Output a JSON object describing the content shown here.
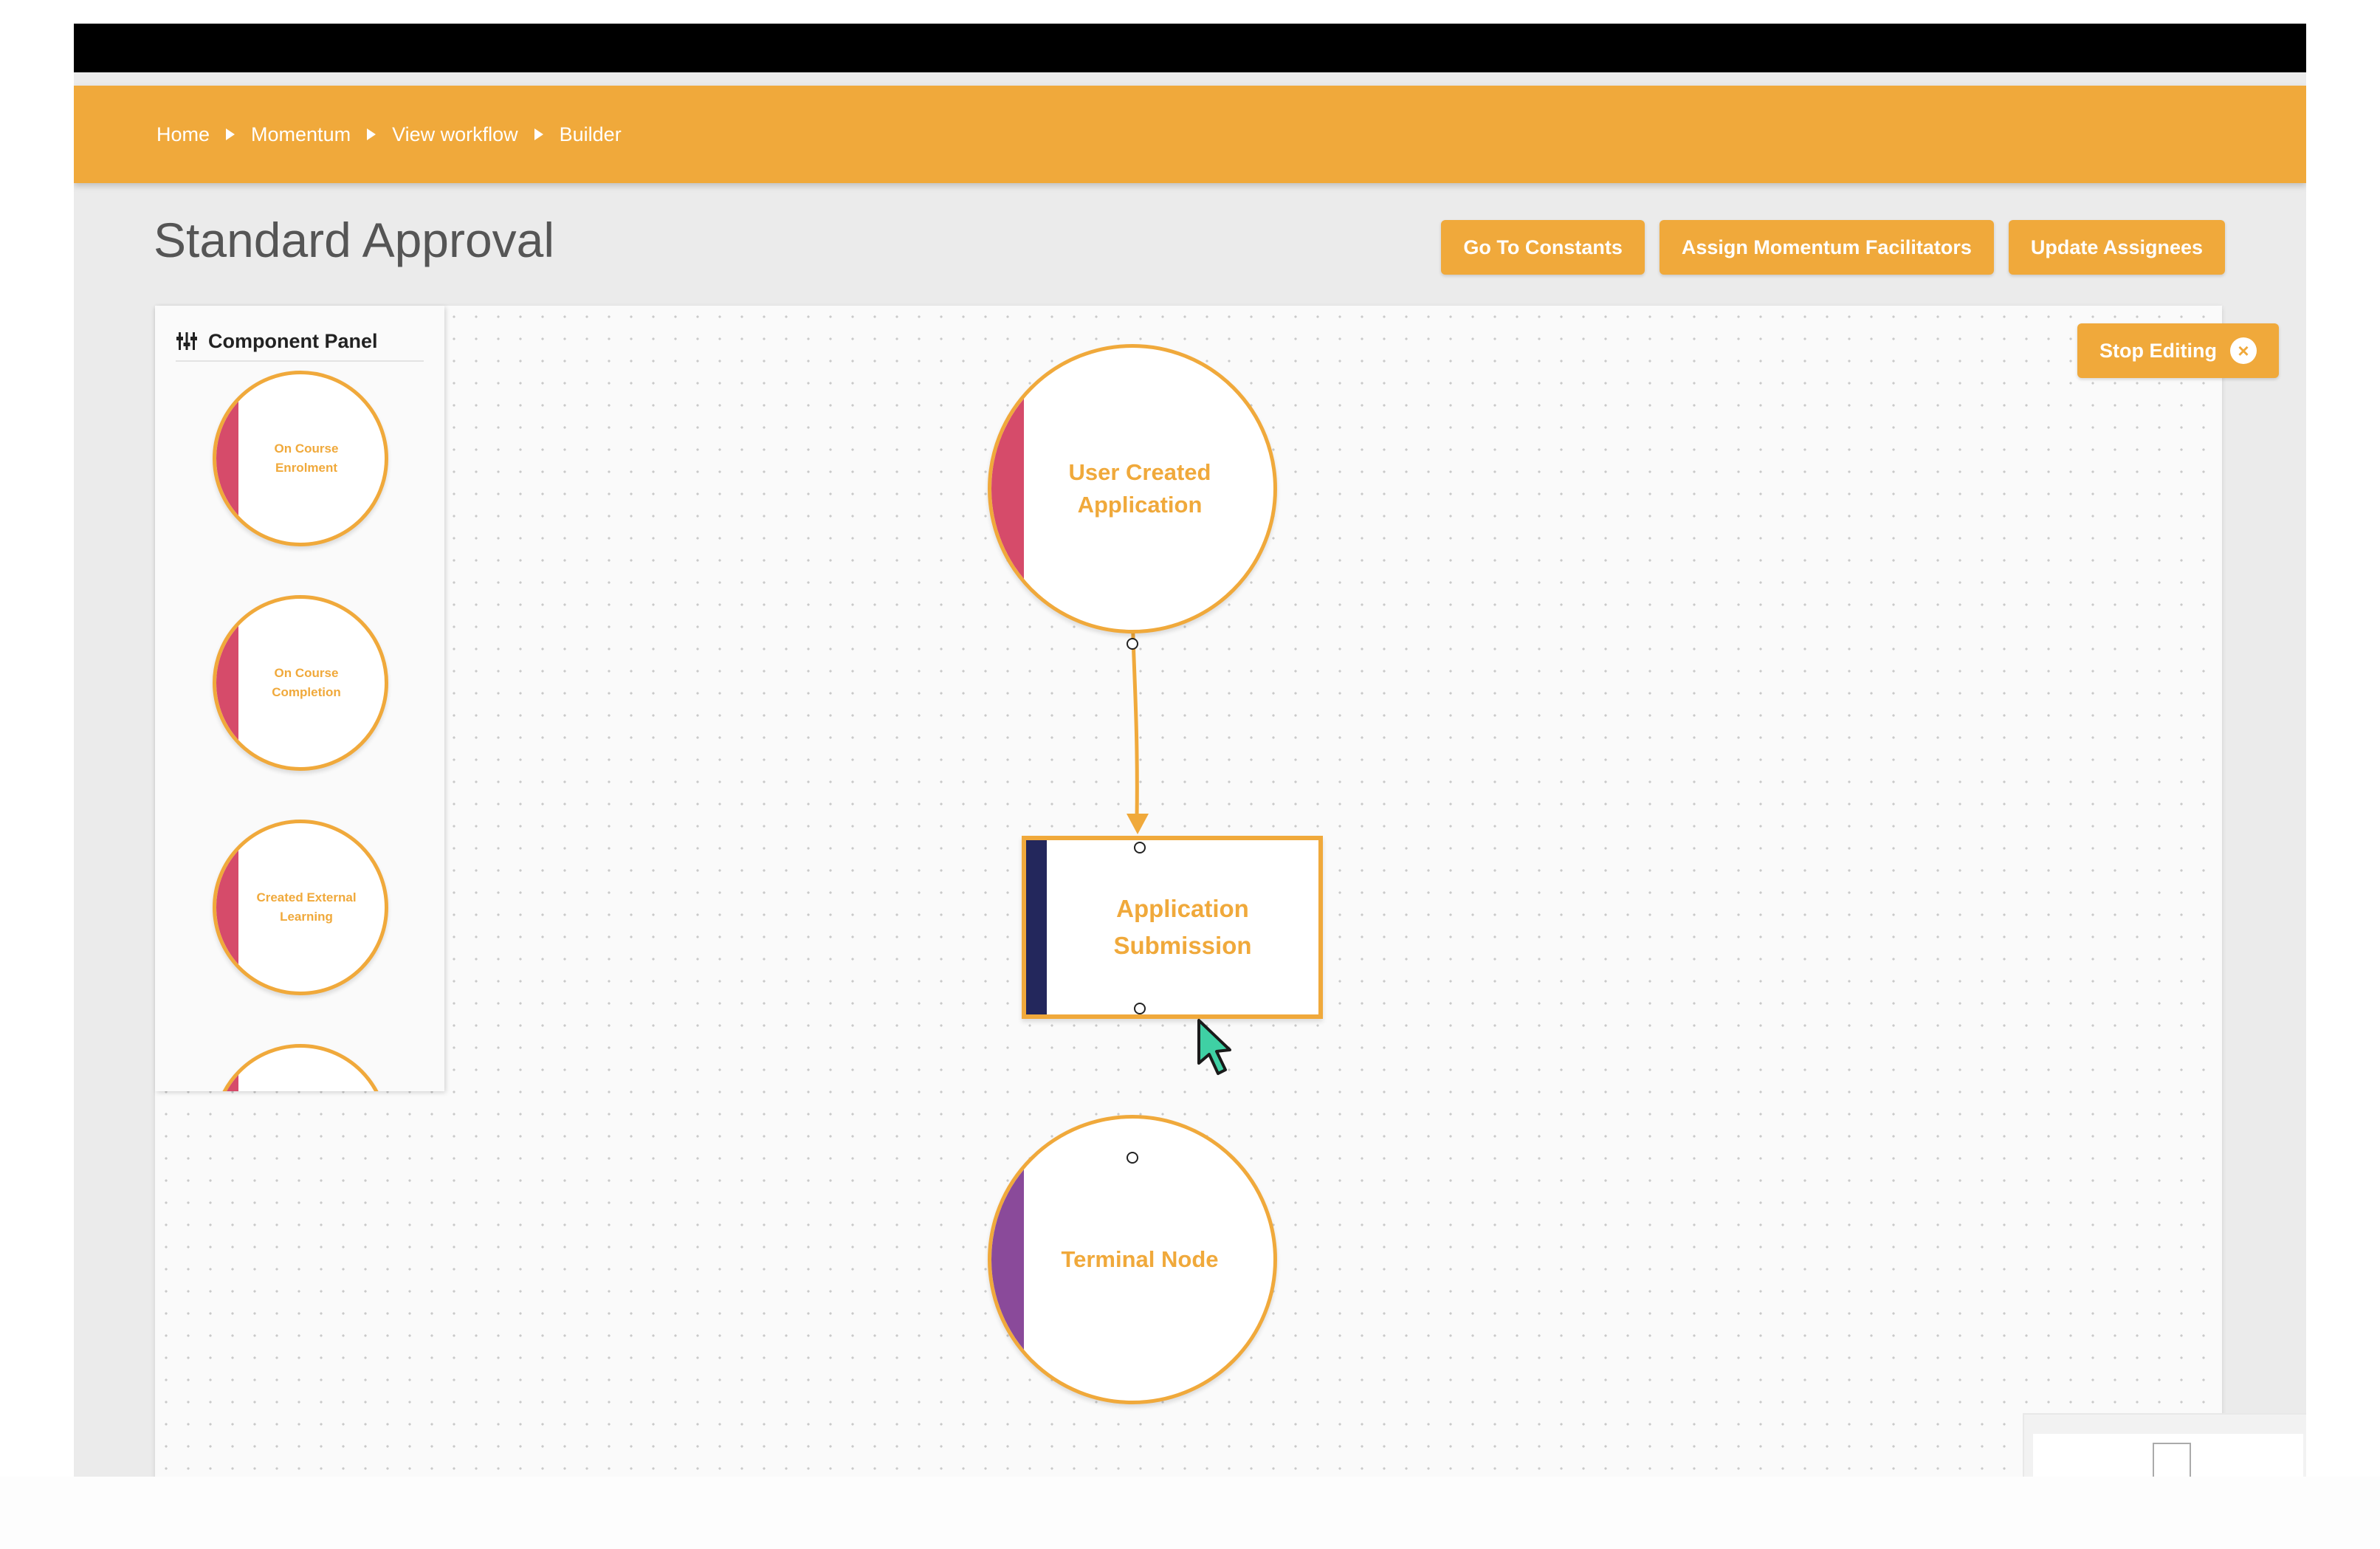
{
  "breadcrumb": {
    "items": [
      "Home",
      "Momentum",
      "View workflow",
      "Builder"
    ]
  },
  "page": {
    "title": "Standard Approval"
  },
  "actions": {
    "constants": "Go To Constants",
    "facilitators": "Assign Momentum Facilitators",
    "assignees": "Update Assignees"
  },
  "component_panel": {
    "title": "Component Panel",
    "title_icon": "sliders-icon",
    "items": [
      "On Course Enrolment",
      "On Course Completion",
      "Created External Learning",
      ""
    ]
  },
  "canvas": {
    "stop_editing": "Stop Editing",
    "stop_editing_icon": "close-circle-icon",
    "zoom_in": "+"
  },
  "workflow": {
    "nodes": [
      {
        "label": "User Created Application",
        "shape": "circle",
        "accent": "#d64b6a"
      },
      {
        "label": "Application Submission",
        "shape": "rectangle",
        "accent": "#23275c"
      },
      {
        "label": "Terminal Node",
        "shape": "circle",
        "accent": "#8a4a9a"
      }
    ],
    "edges": [
      {
        "from": "User Created Application",
        "to": "Application Submission"
      }
    ]
  },
  "colors": {
    "brand": "#f0a93b",
    "background": "#ebebeb",
    "cursor": "#3fd0a4"
  }
}
